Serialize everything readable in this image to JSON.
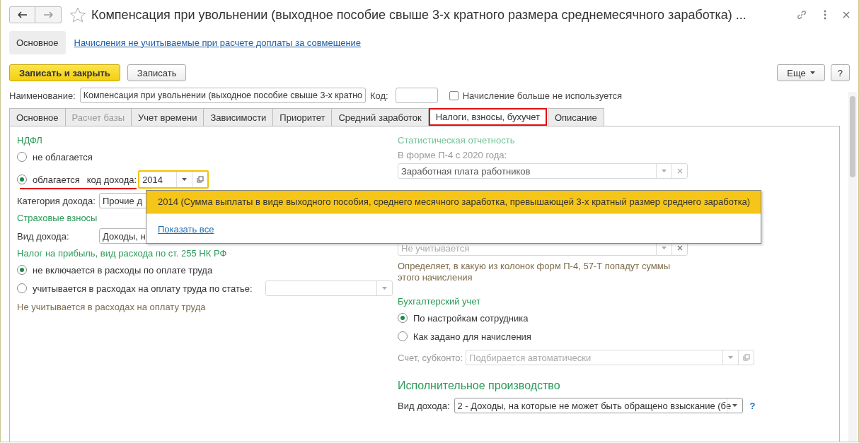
{
  "window": {
    "title": "Компенсация при увольнении (выходное пособие свыше 3-х кратного размера среднемесячного заработка) ..."
  },
  "nav": [
    {
      "label": "Основное",
      "selected": true
    },
    {
      "label": "Начисления не учитываемые при расчете доплаты за совмещение",
      "selected": false
    }
  ],
  "toolbar": {
    "primary": "Записать и закрыть",
    "secondary": "Записать",
    "more": "Еще",
    "help": "?"
  },
  "name_row": {
    "label": "Наименование:",
    "value": "Компенсация при увольнении (выходное пособие свыше 3-х кратно",
    "code_label": "Код:",
    "unused": {
      "label": "Начисление больше не используется",
      "checked": false
    }
  },
  "tabs": [
    {
      "label": "Основное",
      "selected": false,
      "disabled": false
    },
    {
      "label": "Расчет базы",
      "selected": false,
      "disabled": true
    },
    {
      "label": "Учет времени",
      "selected": false,
      "disabled": false
    },
    {
      "label": "Зависимости",
      "selected": false,
      "disabled": false
    },
    {
      "label": "Приоритет",
      "selected": false,
      "disabled": false
    },
    {
      "label": "Средний заработок",
      "selected": false,
      "disabled": false
    },
    {
      "label": "Налоги, взносы, бухучет",
      "selected": true,
      "disabled": false
    },
    {
      "label": "Описание",
      "selected": false,
      "disabled": false
    }
  ],
  "left": {
    "ndfl": {
      "heading": "НДФЛ",
      "options": [
        {
          "label": "не облагается",
          "selected": false
        },
        {
          "label": "облагается",
          "selected": true
        }
      ],
      "code_label": "код дохода:",
      "code_value": "2014"
    },
    "category": {
      "label": "Категория дохода:",
      "value": "Прочие д"
    },
    "insurance": {
      "heading": "Страховые взносы",
      "label": "Вид дохода:",
      "value": "Доходы, н"
    },
    "profit": {
      "heading": "Налог на прибыль, вид расхода по ст. 255 НК РФ",
      "options": [
        {
          "label": "не включается в расходы по оплате труда",
          "selected": true
        },
        {
          "label": "учитывается в расходах на оплату труда по статье:",
          "selected": false
        }
      ],
      "note": "Не учитывается в расходах на оплату труда"
    }
  },
  "right": {
    "stats": {
      "heading": "Статистическая отчетность",
      "label": "В форме П-4 с 2020 года:",
      "value": "Заработная плата работников",
      "value_2": "Не учитывается",
      "note": "Определяет, в какую из колонок форм П-4, 57-Т попадут суммы этого начисления"
    },
    "accounting": {
      "heading": "Бухгалтерский учет",
      "options": [
        {
          "label": "По настройкам сотрудника",
          "selected": true
        },
        {
          "label": "Как задано для начисления",
          "selected": false
        }
      ],
      "account_label": "Счет, субконто:",
      "account_placeholder": "Подбирается автоматически"
    },
    "enforcement": {
      "heading": "Исполнительное производство",
      "label": "Вид дохода:",
      "value": "2 - Доходы, на которые не может быть обращено взыскание (бе",
      "help": "?"
    }
  },
  "popup": {
    "items": [
      {
        "label": "2014 (Сумма выплаты в виде выходного пособия, среднего месячного заработка, превышающей 3-х кратный размер среднего заработка)",
        "selected": true
      }
    ],
    "link": "Показать все"
  }
}
